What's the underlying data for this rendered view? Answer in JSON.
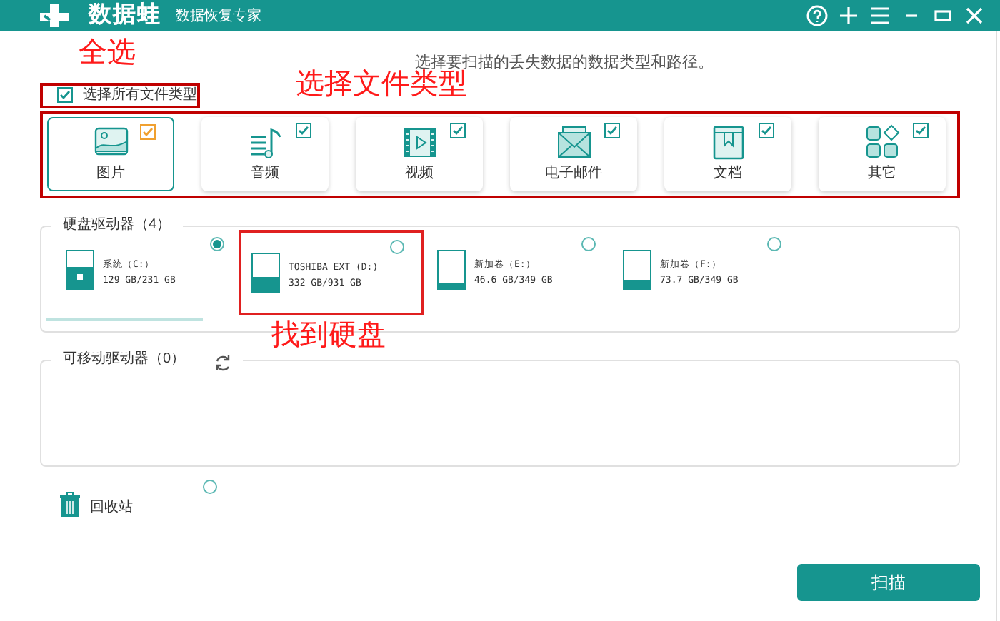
{
  "title_bar": {
    "app_name": "数据蛙",
    "subtitle": "数据恢复专家"
  },
  "instruction": "选择要扫描的丢失数据的数据类型和路径。",
  "select_all": {
    "label": "选择所有文件类型",
    "checked": true
  },
  "file_types": [
    {
      "label": "图片",
      "checked": true,
      "selected": true,
      "kind": "image"
    },
    {
      "label": "音频",
      "checked": true,
      "selected": false,
      "kind": "audio"
    },
    {
      "label": "视频",
      "checked": true,
      "selected": false,
      "kind": "video"
    },
    {
      "label": "电子邮件",
      "checked": true,
      "selected": false,
      "kind": "email"
    },
    {
      "label": "文档",
      "checked": true,
      "selected": false,
      "kind": "document"
    },
    {
      "label": "其它",
      "checked": true,
      "selected": false,
      "kind": "other"
    }
  ],
  "hard_drives": {
    "title": "硬盘驱动器（4）",
    "drives": [
      {
        "name": "系统（C:）",
        "usage": "129 GB/231 GB",
        "level": 0.56,
        "selected": true,
        "kind": "system",
        "highlighted": false
      },
      {
        "name": "TOSHIBA EXT (D:)",
        "usage": "332 GB/931 GB",
        "level": 0.36,
        "selected": false,
        "kind": "disk",
        "highlighted": true
      },
      {
        "name": "新加卷（E:）",
        "usage": "46.6 GB/349 GB",
        "level": 0.13,
        "selected": false,
        "kind": "disk",
        "highlighted": false
      },
      {
        "name": "新加卷（F:）",
        "usage": "73.7 GB/349 GB",
        "level": 0.21,
        "selected": false,
        "kind": "disk",
        "highlighted": false
      }
    ]
  },
  "removable_drives": {
    "title": "可移动驱动器（0）"
  },
  "recycle_bin": {
    "label": "回收站",
    "selected": false
  },
  "scan_button": "扫描",
  "annotations": [
    "全选",
    "选择文件类型",
    "找到硬盘"
  ]
}
